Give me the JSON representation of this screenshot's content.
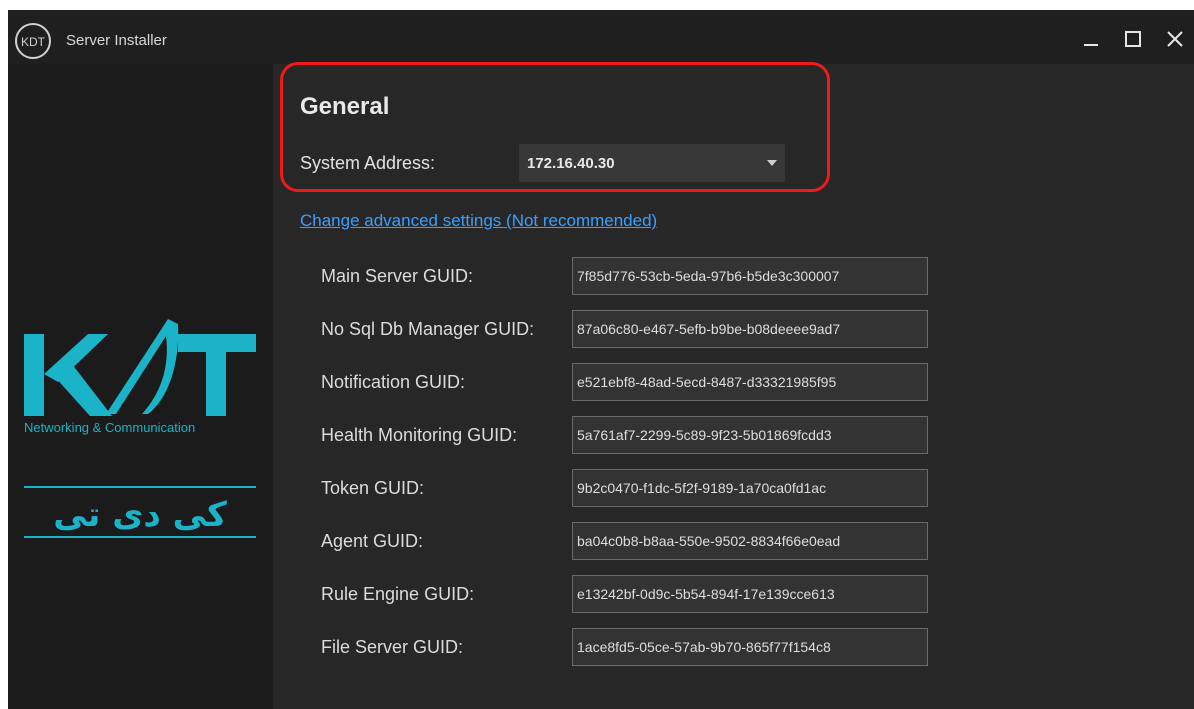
{
  "window": {
    "title": "Server Installer",
    "controls": [
      "minimize",
      "maximize",
      "close"
    ]
  },
  "brand": {
    "logo_text": "KDT",
    "tagline": "Networking & Communication",
    "persian_name": "کی دی تی",
    "accent_color": "#1ab3c7"
  },
  "general": {
    "title": "General",
    "system_address_label": "System Address:",
    "system_address_value": "172.16.40.30",
    "advanced_link": "Change advanced settings (Not recommended)"
  },
  "guids": [
    {
      "label": "Main Server GUID:",
      "value": "7f85d776-53cb-5eda-97b6-b5de3c300007"
    },
    {
      "label": "No Sql Db Manager GUID:",
      "value": "87a06c80-e467-5efb-b9be-b08deeee9ad7"
    },
    {
      "label": "Notification GUID:",
      "value": "e521ebf8-48ad-5ecd-8487-d33321985f95"
    },
    {
      "label": "Health Monitoring GUID:",
      "value": "5a761af7-2299-5c89-9f23-5b01869fcdd3"
    },
    {
      "label": "Token GUID:",
      "value": "9b2c0470-f1dc-5f2f-9189-1a70ca0fd1ac"
    },
    {
      "label": "Agent GUID:",
      "value": "ba04c0b8-b8aa-550e-9502-8834f66e0ead"
    },
    {
      "label": "Rule Engine GUID:",
      "value": "e13242bf-0d9c-5b54-894f-17e139cce613"
    },
    {
      "label": "File Server GUID:",
      "value": "1ace8fd5-05ce-57ab-9b70-865f77f154c8"
    }
  ],
  "colors": {
    "highlight": "#ef1b1b",
    "link": "#3aa0ff"
  }
}
